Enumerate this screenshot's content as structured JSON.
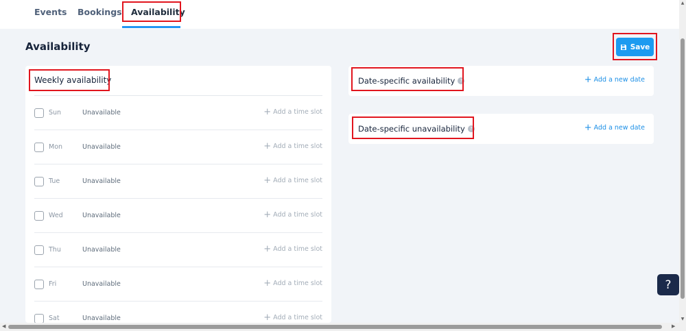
{
  "tabs": [
    {
      "label": "Events"
    },
    {
      "label": "Bookings"
    },
    {
      "label": "Availability",
      "active": true
    }
  ],
  "page": {
    "title": "Availability"
  },
  "save": {
    "label": "Save",
    "icon": "floppy-disk-icon"
  },
  "weekly": {
    "title": "Weekly availability",
    "add_label": "Add a time slot",
    "days": [
      {
        "name": "Sun",
        "status": "Unavailable"
      },
      {
        "name": "Mon",
        "status": "Unavailable"
      },
      {
        "name": "Tue",
        "status": "Unavailable"
      },
      {
        "name": "Wed",
        "status": "Unavailable"
      },
      {
        "name": "Thu",
        "status": "Unavailable"
      },
      {
        "name": "Fri",
        "status": "Unavailable"
      },
      {
        "name": "Sat",
        "status": "Unavailable"
      }
    ]
  },
  "date_specific": {
    "availability_title": "Date-specific availability",
    "unavailability_title": "Date-specific unavailability",
    "add_label": "Add a new date"
  },
  "help": {
    "label": "?"
  },
  "colors": {
    "accent": "#1c9bf0",
    "highlight": "#e1141d",
    "help_bubble": "#1b2a4a"
  }
}
